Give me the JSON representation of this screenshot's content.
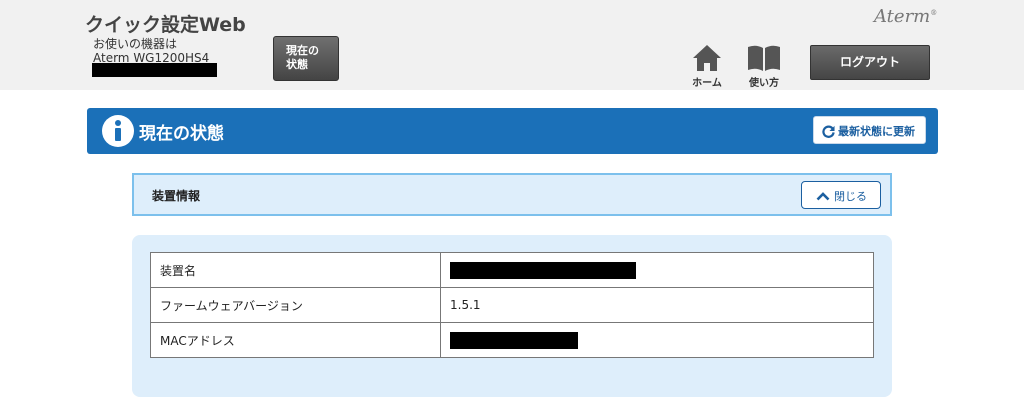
{
  "header": {
    "app_title": "クイック設定Web",
    "device_label": "お使いの機器は",
    "device_model": "Aterm WG1200HS4",
    "status_button": "現在の\n状態",
    "brand_logo": "Aterm",
    "brand_mark": "®",
    "nav": {
      "home_label": "ホーム",
      "manual_label": "使い方"
    },
    "logout_label": "ログアウト"
  },
  "title_band": {
    "title": "現在の状態",
    "refresh_label": "最新状態に更新"
  },
  "section": {
    "title": "装置情報",
    "close_label": "閉じる"
  },
  "device_info": {
    "rows": [
      {
        "label": "装置名",
        "value": ""
      },
      {
        "label": "ファームウェアバージョン",
        "value": "1.5.1"
      },
      {
        "label": "MACアドレス",
        "value": ""
      }
    ]
  },
  "colors": {
    "title_band": "#1b70b8",
    "section_bg": "#deeefb",
    "section_border": "#7cc0ec",
    "header_bg": "#f1f1f1",
    "button_dark": "#555555"
  },
  "icons": [
    "home-icon",
    "book-icon",
    "info-icon",
    "refresh-icon",
    "chevron-up-icon"
  ]
}
